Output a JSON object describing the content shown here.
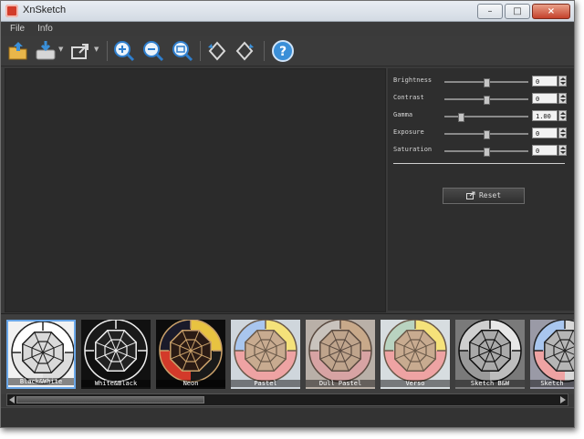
{
  "window": {
    "title": "XnSketch",
    "controls": {
      "minimize": "–",
      "maximize": "□",
      "close": "×"
    }
  },
  "menu": [
    {
      "label": "File"
    },
    {
      "label": "Info"
    }
  ],
  "toolbar": [
    {
      "name": "open-folder-icon"
    },
    {
      "name": "save-icon"
    },
    {
      "name": "export-icon"
    },
    {
      "name": "zoom-in-icon"
    },
    {
      "name": "zoom-out-icon"
    },
    {
      "name": "zoom-fit-icon"
    },
    {
      "name": "rotate-left-icon"
    },
    {
      "name": "rotate-right-icon"
    },
    {
      "name": "help-icon"
    }
  ],
  "adjustments": [
    {
      "label": "Brightness",
      "value": "0",
      "level": 0.5
    },
    {
      "label": "Contrast",
      "value": "0",
      "level": 0.5
    },
    {
      "label": "Gamma",
      "value": "1.00",
      "level": 0.2
    },
    {
      "label": "Exposure",
      "value": "0",
      "level": 0.5
    },
    {
      "label": "Saturation",
      "value": "0",
      "level": 0.5
    }
  ],
  "reset_label": "Reset",
  "presets": [
    {
      "label": "Black&White",
      "style": "bw",
      "selected": true
    },
    {
      "label": "White&Black",
      "style": "wb",
      "selected": false
    },
    {
      "label": "Neon",
      "style": "neon",
      "selected": false
    },
    {
      "label": "Pastel",
      "style": "pastel",
      "selected": false
    },
    {
      "label": "Dull Pastel",
      "style": "dull",
      "selected": false
    },
    {
      "label": "Verso",
      "style": "verso",
      "selected": false
    },
    {
      "label": "Sketch B&W",
      "style": "sketch",
      "selected": false
    },
    {
      "label": "Sketch",
      "style": "sketchc",
      "selected": false
    }
  ],
  "colors": {
    "accent": "#6aa7e8",
    "pastel_yellow": "#f5e27a",
    "pastel_blue": "#a9c6ee",
    "pastel_red": "#eea3a3",
    "pastel_tan": "#c8ab90",
    "neon_red": "#d33a2a",
    "neon_yellow": "#e8c341"
  }
}
